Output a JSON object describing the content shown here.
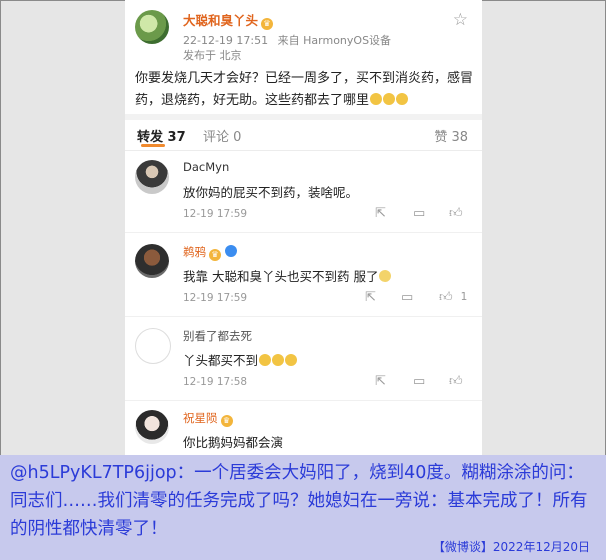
{
  "post": {
    "username": "大聪和臭丫头",
    "timestamp": "22-12-19 17:51",
    "device": "来自 HarmonyOS设备",
    "location": "发布于 北京",
    "text": "你要发烧几天才会好？已经一周多了，买不到消炎药，感冒药，退烧药，好无助。这些药都去了哪里",
    "star_icon": "star-outline-icon"
  },
  "tabs": {
    "repost_label": "转发 37",
    "comment_label": "评论 0",
    "like_label": "赞 38",
    "active_color": "#f08a2e"
  },
  "comments": [
    {
      "name": "DacMyn",
      "name_color": "#333333",
      "text": "放你妈的屁买不到药，装啥呢。",
      "time": "12-19 17:59",
      "like_count": ""
    },
    {
      "name": "鹈鸦",
      "name_color": "#e0651e",
      "text": "我靠 大聪和臭丫头也买不到药 服了",
      "time": "12-19 17:59",
      "like_count": "1"
    },
    {
      "name": "别看了都去死",
      "name_color": "#555555",
      "text": "丫头都买不到",
      "time": "12-19 17:58",
      "like_count": ""
    },
    {
      "name": "祝星陨",
      "name_color": "#e0651e",
      "text": "你比鹅妈妈都会演",
      "time": "",
      "like_count": ""
    }
  ],
  "caption": {
    "text": "@h5LPyKL7TP6jjop：一个居委会大妈阳了，烧到40度。糊糊涂涂的问：同志们……我们清零的任务完成了吗？她媳妇在一旁说：基本完成了！所有的阴性都快清零了！",
    "credit": "【微博谈】2022年12月20日",
    "background": "#c7c9ed",
    "text_color": "#2b3bd8"
  }
}
